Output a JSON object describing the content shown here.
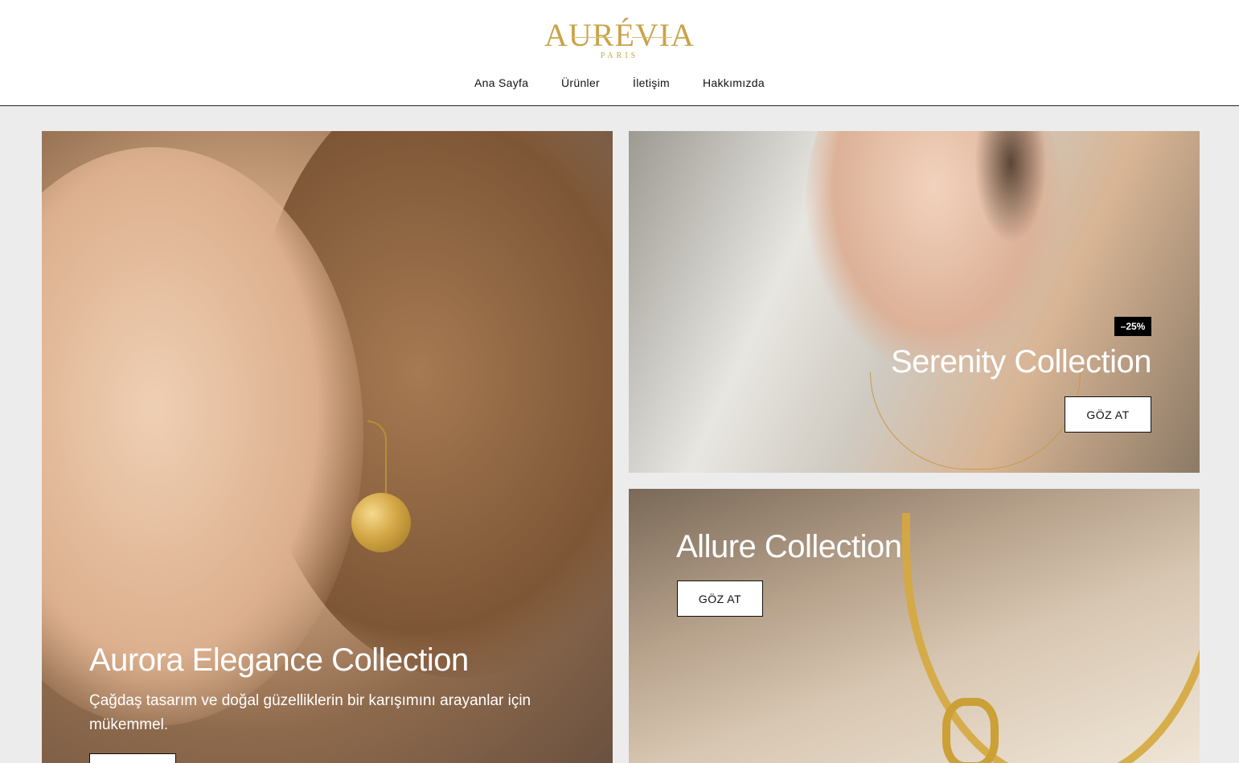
{
  "brand": {
    "name": "AURÉVIA",
    "tagline": "PARIS",
    "color": "#c9a34a"
  },
  "nav": {
    "items": [
      {
        "label": "Ana Sayfa"
      },
      {
        "label": "Ürünler"
      },
      {
        "label": "İletişim"
      },
      {
        "label": "Hakkımızda"
      }
    ]
  },
  "collections": {
    "aurora": {
      "title": "Aurora Elegance Collection",
      "description": "Çağdaş tasarım ve doğal güzelliklerin bir karışımını arayanlar için mükemmel."
    },
    "serenity": {
      "badge": "–25%",
      "title": "Serenity Collection",
      "button": "GÖZ AT"
    },
    "allure": {
      "title": "Allure Collection",
      "button": "GÖZ AT"
    }
  }
}
